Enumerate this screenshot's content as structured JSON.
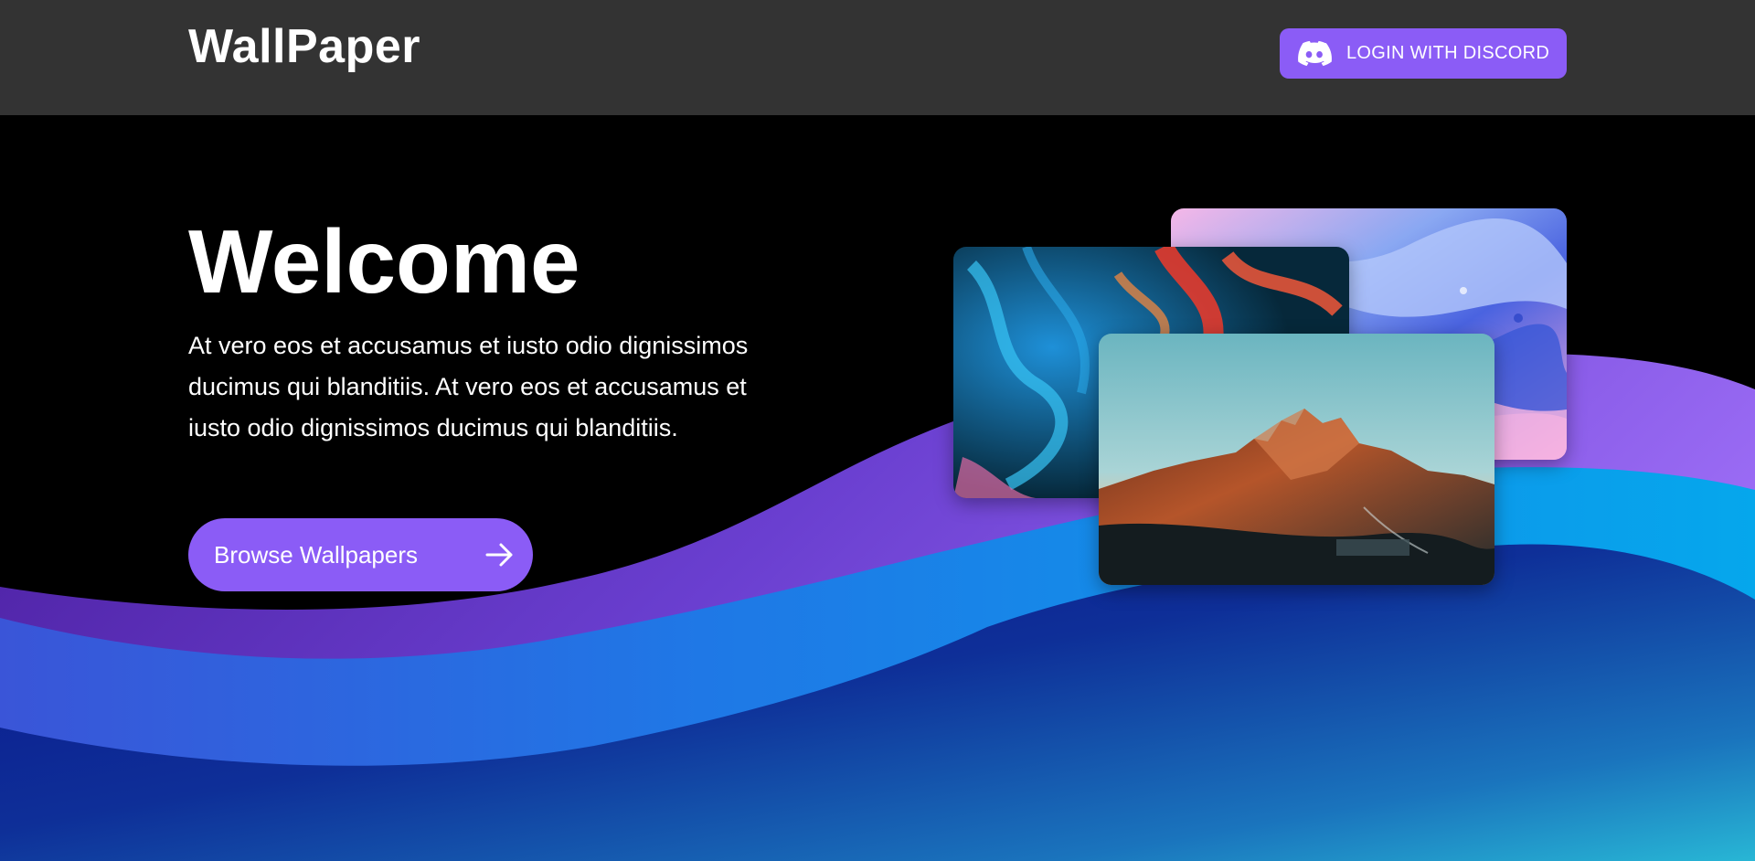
{
  "navbar": {
    "brand": "WallPaper",
    "login_label": "LOGIN WITH DISCORD"
  },
  "hero": {
    "title": "Welcome",
    "description": "At vero eos et accusamus et iusto odio dignissimos ducimus qui blanditiis. At vero eos et accusamus et iusto odio dignissimos ducimus qui blanditiis.",
    "browse_label": "Browse Wallpapers"
  },
  "icons": {
    "login": "discord-icon",
    "browse": "arrow-right-icon"
  },
  "colors": {
    "navbar_bg": "#333333",
    "accent": "#8b5cf6",
    "hero_bg": "#000000",
    "wave_purple": "#7c4ddb",
    "wave_blue": "#0ea5e9",
    "wave_navy": "#0a1a8c",
    "wave_teal": "#26b4d4"
  },
  "gallery": {
    "images": [
      "liquid-paint-wallpaper",
      "colored-smoke-wallpaper",
      "mountain-sunset-wallpaper"
    ]
  }
}
